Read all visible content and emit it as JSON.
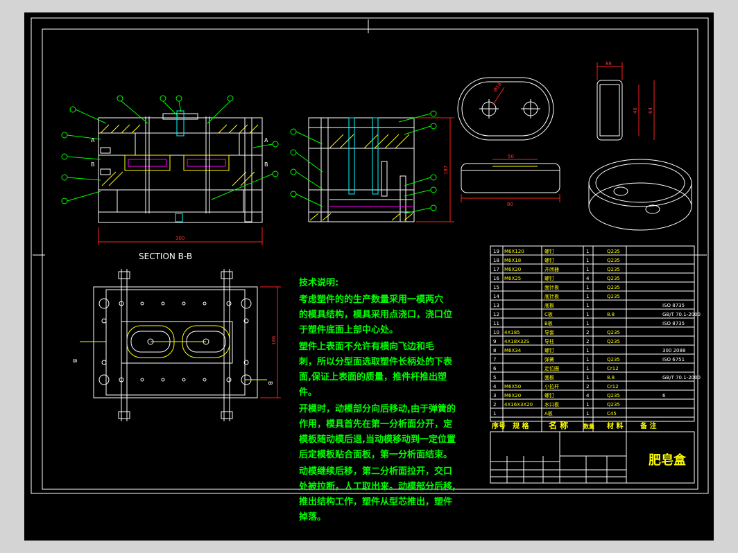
{
  "section_label": "SECTION B-B",
  "dims": {
    "width_300": "300",
    "height_187": "187",
    "width_80": "80",
    "width_50": "50",
    "top_88": "88",
    "h_46": "46",
    "h_64": "64",
    "d_16": "Ø16",
    "plan_186": "186"
  },
  "labels": {
    "A_left": "A",
    "B_left": "B",
    "A_right": "A",
    "B_right": "B",
    "B_plan_left": "B",
    "B_plan_right": "B"
  },
  "notes": {
    "title": "技术说明:",
    "lines": [
      "    考虑塑件的的生产数量采用一模两穴",
      "的模具结构，模具采用点浇口，浇口位",
      "于塑件底面上部中心处。",
      "    塑件上表面不允许有横向飞边和毛",
      "刺，所以分型面选取塑件长柄处的下表",
      "面,保证上表面的质量，推件杆推出塑",
      "件。",
      "开模时，动模部分向后移动,由于弹簧的",
      "作用，模具首先在第一分析面分开，定",
      "模板随动模后退,当动模移动到一定位置",
      "后定模板贴合面板，第一分析面结束。",
      "动模继续后移，第二分析面拉开，交口",
      "处被拉断，人工取出来。动模部分后移,",
      "推出结构工作，塑件从型芯推出，塑件",
      "掉落。"
    ]
  },
  "bom": {
    "rows": [
      {
        "no": "19",
        "std": "M6X120",
        "name": "螺钉",
        "qty": "1",
        "mat": "Q235",
        "note": ""
      },
      {
        "no": "18",
        "std": "M6X18",
        "name": "螺钉",
        "qty": "1",
        "mat": "Q235",
        "note": ""
      },
      {
        "no": "17",
        "std": "M6X20",
        "name": "开闭器",
        "qty": "1",
        "mat": "Q235",
        "note": ""
      },
      {
        "no": "16",
        "std": "M6X25",
        "name": "螺钉",
        "qty": "4",
        "mat": "Q235",
        "note": ""
      },
      {
        "no": "15",
        "std": "",
        "name": "面针板",
        "qty": "1",
        "mat": "Q235",
        "note": ""
      },
      {
        "no": "14",
        "std": "",
        "name": "底针板",
        "qty": "1",
        "mat": "Q235",
        "note": ""
      },
      {
        "no": "13",
        "std": "",
        "name": "底板",
        "qty": "1",
        "mat": "",
        "note": "ISO 8735"
      },
      {
        "no": "12",
        "std": "",
        "name": "C板",
        "qty": "1",
        "mat": "8.8",
        "note": "GB/T 70.1-2000"
      },
      {
        "no": "11",
        "std": "",
        "name": "B板",
        "qty": "1",
        "mat": "",
        "note": "ISO 8735"
      },
      {
        "no": "10",
        "std": "4X185",
        "name": "导套",
        "qty": "2",
        "mat": "Q235",
        "note": ""
      },
      {
        "no": "9",
        "std": "4X18X32S",
        "name": "导柱",
        "qty": "2",
        "mat": "Q235",
        "note": ""
      },
      {
        "no": "8",
        "std": "M6X34",
        "name": "螺钉",
        "qty": "1",
        "mat": "",
        "note": "300 2088"
      },
      {
        "no": "7",
        "std": "",
        "name": "弹簧",
        "qty": "1",
        "mat": "Q235",
        "note": "ISO 6751"
      },
      {
        "no": "6",
        "std": "",
        "name": "定位圈",
        "qty": "1",
        "mat": "Cr12",
        "note": ""
      },
      {
        "no": "5",
        "std": "",
        "name": "面板",
        "qty": "1",
        "mat": "8.8",
        "note": "GB/T 70.1-2000"
      },
      {
        "no": "4",
        "std": "M6X50",
        "name": "小拉杆",
        "qty": "2",
        "mat": "Cr12",
        "note": ""
      },
      {
        "no": "3",
        "std": "M6X20",
        "name": "螺钉",
        "qty": "4",
        "mat": "Q235",
        "note": "6"
      },
      {
        "no": "2",
        "std": "4X16X3X20",
        "name": "水口板",
        "qty": "1",
        "mat": "Q235",
        "note": ""
      },
      {
        "no": "1",
        "std": "",
        "name": "A板",
        "qty": "1",
        "mat": "C45",
        "note": ""
      }
    ],
    "header": {
      "no": "序号",
      "std": "规 格",
      "name": "名 称",
      "qty": "数量",
      "mat": "材 料",
      "note": "备 注"
    },
    "title_block": "肥皂盒"
  }
}
